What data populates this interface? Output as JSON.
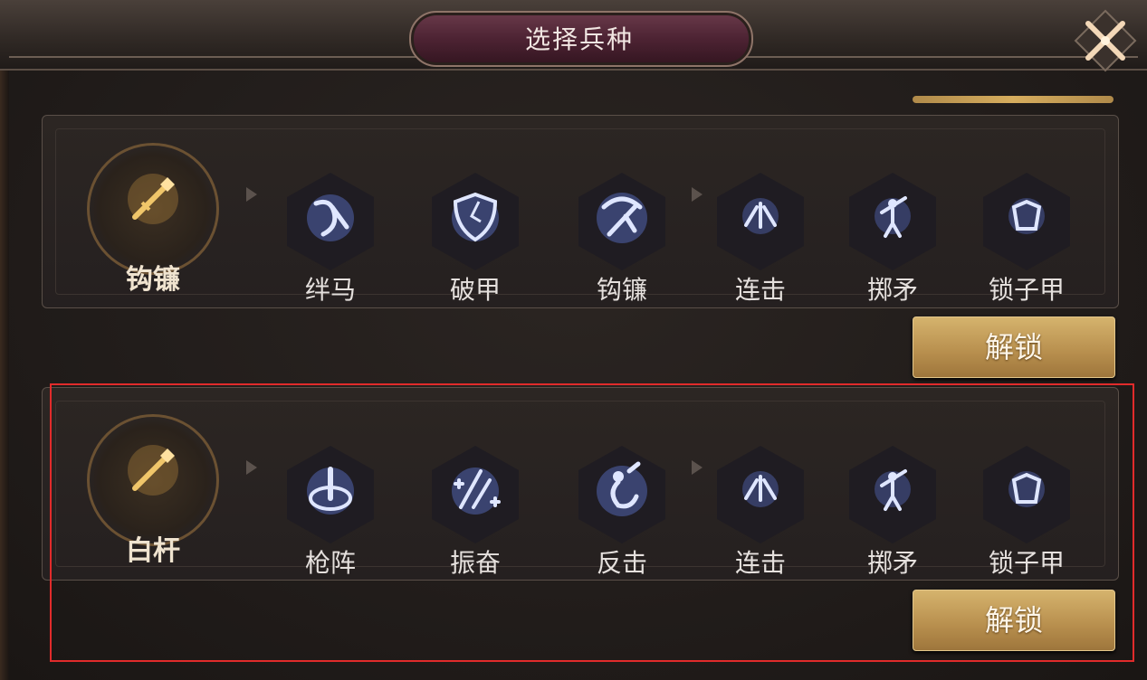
{
  "dialog": {
    "title": "选择兵种",
    "close_icon": "close-x-icon"
  },
  "rows": [
    {
      "unit": {
        "label": "钩镰",
        "icon": "spear-emblem-icon"
      },
      "skills": [
        {
          "label": "绊马",
          "icon": "trip-horse-icon"
        },
        {
          "label": "破甲",
          "icon": "broken-shield-icon"
        },
        {
          "label": "钩镰",
          "icon": "hook-sickle-icon"
        },
        {
          "label": "连击",
          "icon": "combo-strike-icon"
        },
        {
          "label": "掷矛",
          "icon": "javelin-thrower-icon"
        },
        {
          "label": "锁子甲",
          "icon": "chainmail-icon"
        }
      ],
      "unlock_label": "解锁"
    },
    {
      "unit": {
        "label": "白杆",
        "icon": "spear-emblem-icon"
      },
      "skills": [
        {
          "label": "枪阵",
          "icon": "spear-formation-icon"
        },
        {
          "label": "振奋",
          "icon": "inspire-icon"
        },
        {
          "label": "反击",
          "icon": "counterattack-icon"
        },
        {
          "label": "连击",
          "icon": "combo-strike-icon"
        },
        {
          "label": "掷矛",
          "icon": "javelin-thrower-icon"
        },
        {
          "label": "锁子甲",
          "icon": "chainmail-icon"
        }
      ],
      "unlock_label": "解锁"
    }
  ],
  "colors": {
    "accent_gold": "#d6ad5e",
    "skill_glow": "#6e8cff",
    "highlight_border": "#e12b2b"
  }
}
